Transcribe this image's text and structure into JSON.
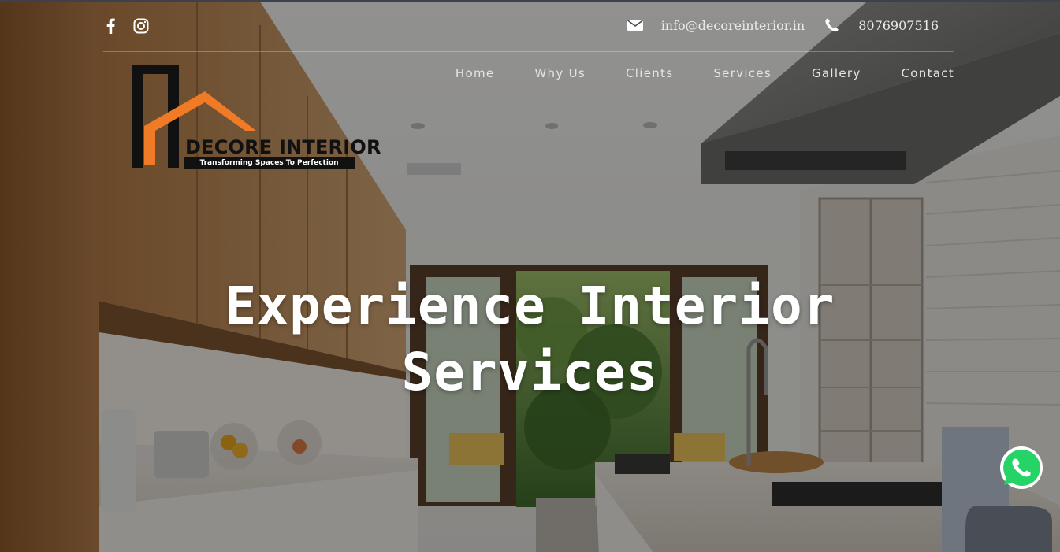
{
  "header": {
    "social": [
      {
        "icon": "facebook-icon"
      },
      {
        "icon": "instagram-icon"
      }
    ],
    "contact": {
      "email_icon": "envelope-icon",
      "email": "info@decoreinterior.in",
      "phone_icon": "phone-icon",
      "phone": "8076907516"
    }
  },
  "nav": {
    "items": [
      {
        "label": "Home"
      },
      {
        "label": "Why Us"
      },
      {
        "label": "Clients"
      },
      {
        "label": "Services"
      },
      {
        "label": "Gallery"
      },
      {
        "label": "Contact"
      }
    ]
  },
  "logo": {
    "name": "DECORE INTERIOR",
    "tagline": "Transforming Spaces To Perfection"
  },
  "hero": {
    "headline_line1": "Experience Interior",
    "headline_line2": "Services"
  },
  "floating": {
    "whatsapp_icon": "whatsapp-icon"
  },
  "colors": {
    "brand_orange": "#f07a26",
    "logo_black": "#111111",
    "whatsapp_green": "#25d366"
  }
}
